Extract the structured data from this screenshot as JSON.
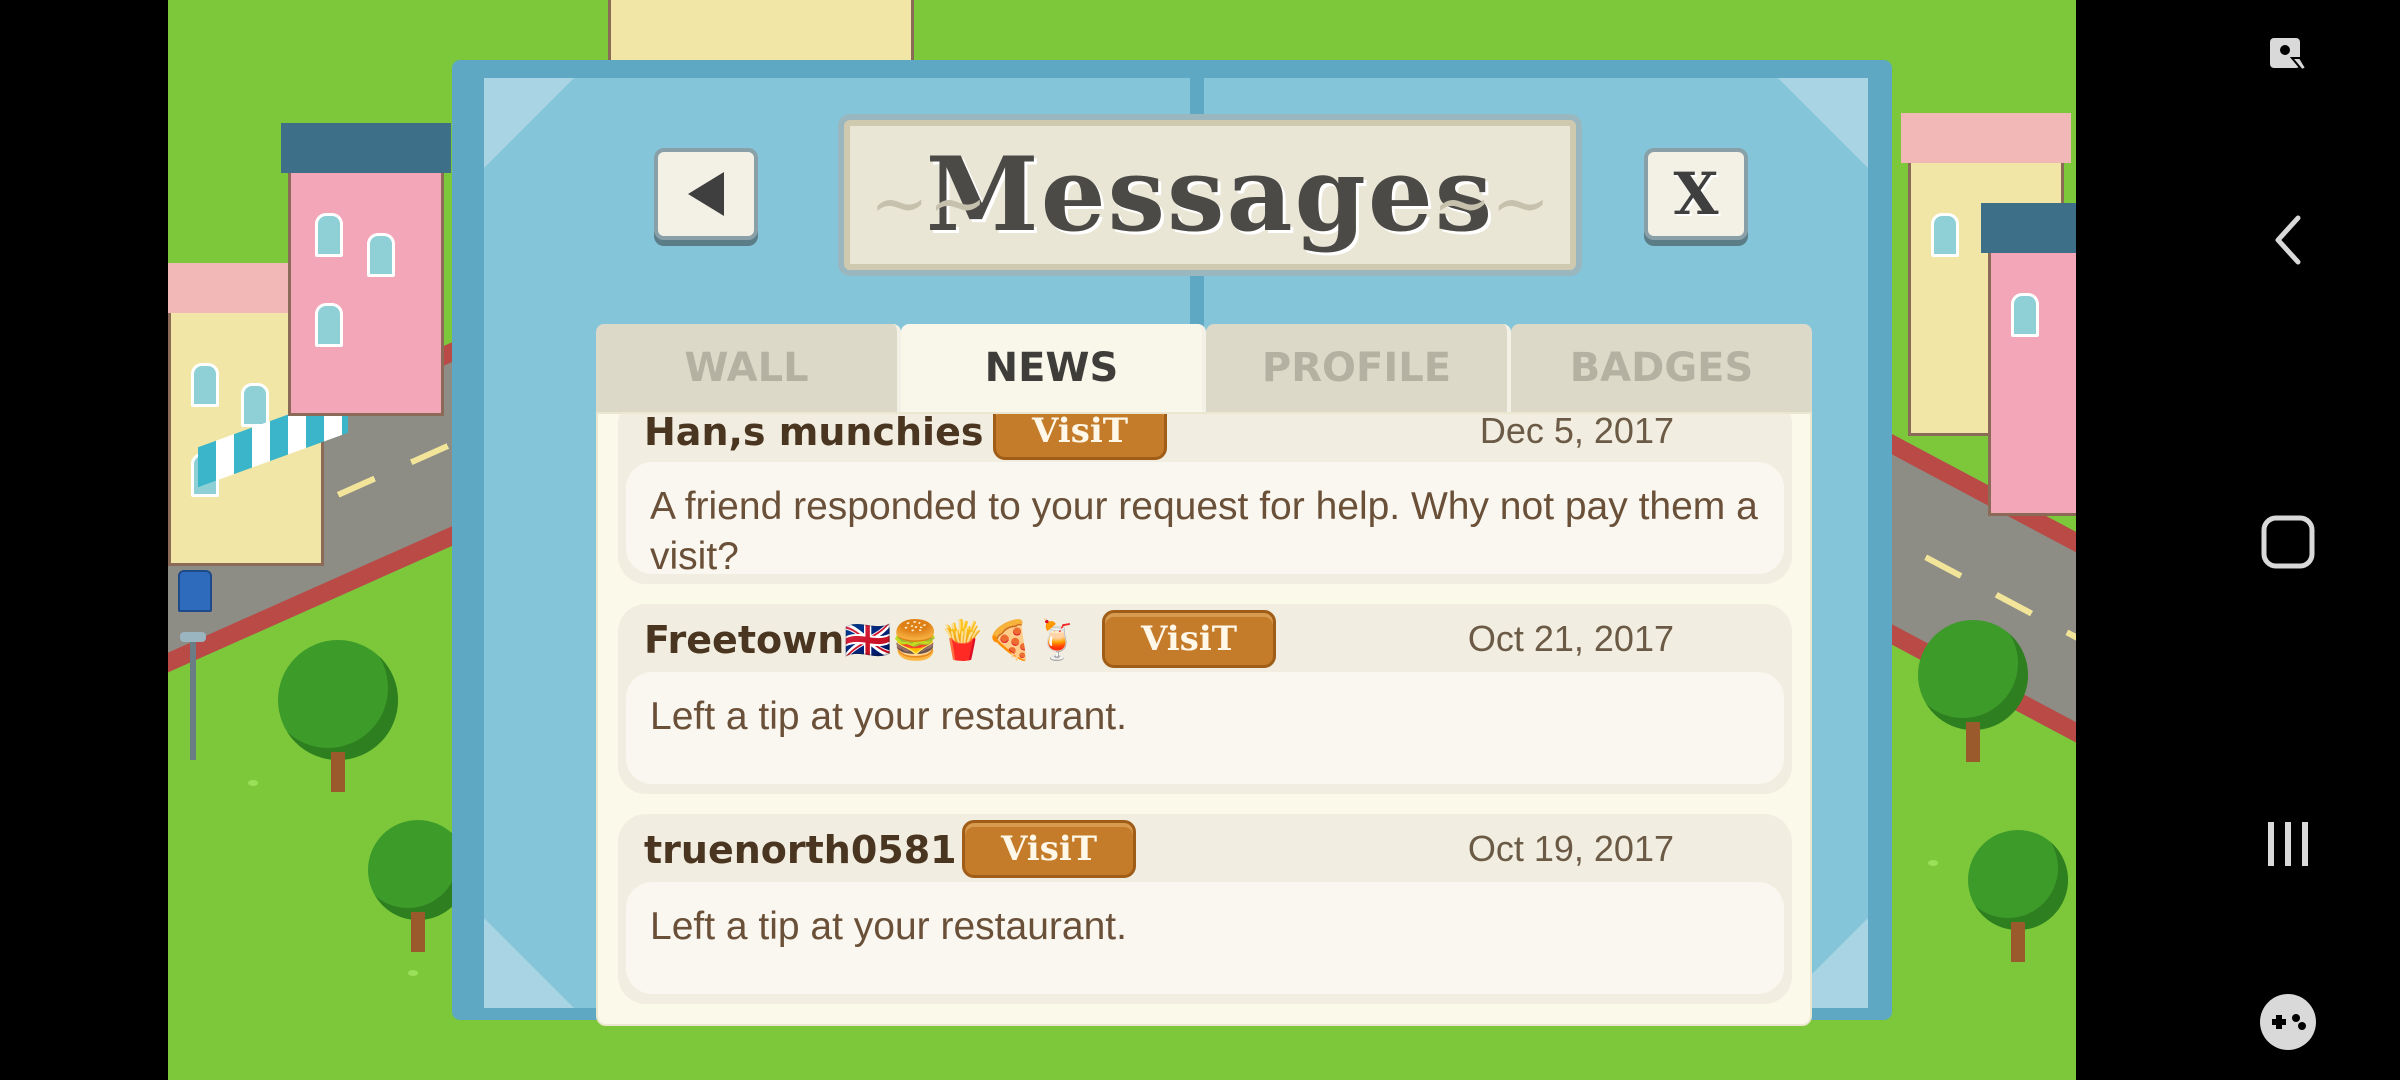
{
  "dialog": {
    "title": "Messages",
    "close_label": "X",
    "tabs": [
      {
        "label": "WALL",
        "active": false
      },
      {
        "label": "NEWS",
        "active": true
      },
      {
        "label": "PROFILE",
        "active": false
      },
      {
        "label": "BADGES",
        "active": false
      }
    ],
    "visit_label": "VisiT",
    "messages": [
      {
        "sender": "Han,s munchies",
        "date": "Dec 5, 2017",
        "body": "A friend responded to your request for help. Why not pay them a visit?"
      },
      {
        "sender": "Freetown🇬🇧🍔🍟🍕🍹",
        "date": "Oct 21, 2017",
        "body": "Left a tip at your restaurant."
      },
      {
        "sender": "truenorth0581",
        "date": "Oct 19, 2017",
        "body": "Left a tip at your restaurant."
      }
    ]
  },
  "navbar": {
    "icons": [
      "screen-assist-icon",
      "back-chevron-icon",
      "home-square-icon",
      "recents-icon",
      "game-tools-icon"
    ]
  },
  "colors": {
    "dialog_frame": "#5ea8c4",
    "dialog_bg": "#84c5d9",
    "visit_button": "#c47b2a",
    "grass": "#7cc83a"
  }
}
